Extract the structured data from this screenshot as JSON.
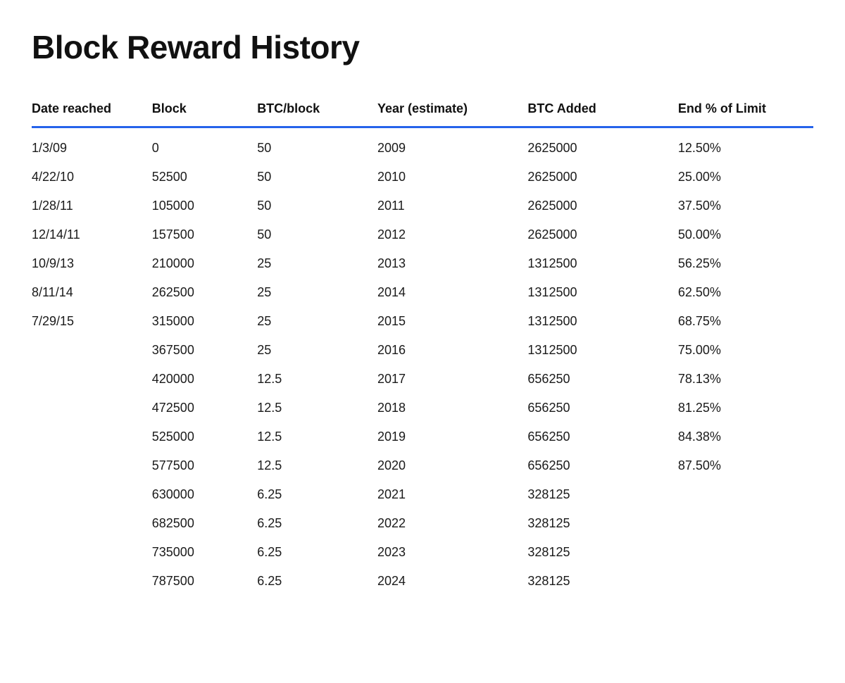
{
  "title": "Block Reward History",
  "columns": [
    {
      "key": "date",
      "label": "Date reached",
      "class": "col-date"
    },
    {
      "key": "block",
      "label": "Block",
      "class": "col-block"
    },
    {
      "key": "btcblock",
      "label": "BTC/block",
      "class": "col-btcblock"
    },
    {
      "key": "year",
      "label": "Year (estimate)",
      "class": "col-year"
    },
    {
      "key": "btcadded",
      "label": "BTC Added",
      "class": "col-btcadded"
    },
    {
      "key": "endlimit",
      "label": "End % of Limit",
      "class": "col-endlimit"
    }
  ],
  "rows": [
    {
      "date": "1/3/09",
      "block": "0",
      "btcblock": "50",
      "year": "2009",
      "btcadded": "2625000",
      "endlimit": "12.50%"
    },
    {
      "date": "4/22/10",
      "block": "52500",
      "btcblock": "50",
      "year": "2010",
      "btcadded": "2625000",
      "endlimit": "25.00%"
    },
    {
      "date": "1/28/11",
      "block": "105000",
      "btcblock": "50",
      "year": "2011",
      "btcadded": "2625000",
      "endlimit": "37.50%"
    },
    {
      "date": "12/14/11",
      "block": "157500",
      "btcblock": "50",
      "year": "2012",
      "btcadded": "2625000",
      "endlimit": "50.00%"
    },
    {
      "date": "10/9/13",
      "block": "210000",
      "btcblock": "25",
      "year": "2013",
      "btcadded": "1312500",
      "endlimit": "56.25%"
    },
    {
      "date": "8/11/14",
      "block": "262500",
      "btcblock": "25",
      "year": "2014",
      "btcadded": "1312500",
      "endlimit": "62.50%"
    },
    {
      "date": "7/29/15",
      "block": "315000",
      "btcblock": "25",
      "year": "2015",
      "btcadded": "1312500",
      "endlimit": "68.75%"
    },
    {
      "date": "",
      "block": "367500",
      "btcblock": "25",
      "year": "2016",
      "btcadded": "1312500",
      "endlimit": "75.00%"
    },
    {
      "date": "",
      "block": "420000",
      "btcblock": "12.5",
      "year": "2017",
      "btcadded": "656250",
      "endlimit": "78.13%"
    },
    {
      "date": "",
      "block": "472500",
      "btcblock": "12.5",
      "year": "2018",
      "btcadded": "656250",
      "endlimit": "81.25%"
    },
    {
      "date": "",
      "block": "525000",
      "btcblock": "12.5",
      "year": "2019",
      "btcadded": "656250",
      "endlimit": "84.38%"
    },
    {
      "date": "",
      "block": "577500",
      "btcblock": "12.5",
      "year": "2020",
      "btcadded": "656250",
      "endlimit": "87.50%"
    },
    {
      "date": "",
      "block": "630000",
      "btcblock": "6.25",
      "year": "2021",
      "btcadded": "328125",
      "endlimit": ""
    },
    {
      "date": "",
      "block": "682500",
      "btcblock": "6.25",
      "year": "2022",
      "btcadded": "328125",
      "endlimit": ""
    },
    {
      "date": "",
      "block": "735000",
      "btcblock": "6.25",
      "year": "2023",
      "btcadded": "328125",
      "endlimit": ""
    },
    {
      "date": "",
      "block": "787500",
      "btcblock": "6.25",
      "year": "2024",
      "btcadded": "328125",
      "endlimit": ""
    }
  ]
}
